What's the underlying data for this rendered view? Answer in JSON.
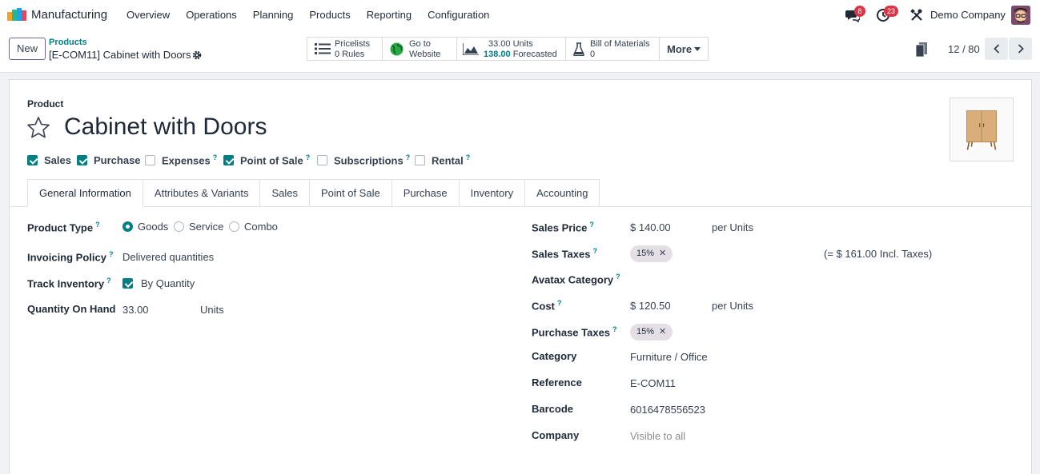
{
  "navbar": {
    "app_name": "Manufacturing",
    "menu": [
      "Overview",
      "Operations",
      "Planning",
      "Products",
      "Reporting",
      "Configuration"
    ],
    "messages_badge": "8",
    "activities_badge": "23",
    "company": "Demo Company"
  },
  "control_panel": {
    "new_label": "New",
    "breadcrumb_parent": "Products",
    "breadcrumb_current": "[E-COM11] Cabinet with Doors",
    "smart_buttons": {
      "pricelists": {
        "line1": "Pricelists",
        "line2": "0 Rules"
      },
      "website": {
        "line1": "Go to",
        "line2": "Website"
      },
      "forecast": {
        "line1": "33.00 Units",
        "line2_value": "138.00",
        "line2_label": "Forecasted"
      },
      "bom": {
        "line1": "Bill of Materials",
        "line2": "0"
      },
      "more": "More"
    },
    "pager": "12 / 80"
  },
  "form": {
    "product_label": "Product",
    "title": "Cabinet with Doors",
    "checkboxes": [
      {
        "label": "Sales",
        "checked": true,
        "help": false
      },
      {
        "label": "Purchase",
        "checked": true,
        "help": false
      },
      {
        "label": "Expenses",
        "checked": false,
        "help": true
      },
      {
        "label": "Point of Sale",
        "checked": true,
        "help": true
      },
      {
        "label": "Subscriptions",
        "checked": false,
        "help": true
      },
      {
        "label": "Rental",
        "checked": false,
        "help": true
      }
    ],
    "tabs": [
      "General Information",
      "Attributes & Variants",
      "Sales",
      "Point of Sale",
      "Purchase",
      "Inventory",
      "Accounting"
    ],
    "left": {
      "product_type_label": "Product Type",
      "product_type_options": [
        "Goods",
        "Service",
        "Combo"
      ],
      "product_type_selected": "Goods",
      "invoicing_policy_label": "Invoicing Policy",
      "invoicing_policy_value": "Delivered quantities",
      "track_inventory_label": "Track Inventory",
      "track_inventory_value": "By Quantity",
      "qty_on_hand_label": "Quantity On Hand",
      "qty_on_hand_value": "33.00",
      "qty_on_hand_uom": "Units"
    },
    "right": {
      "sales_price_label": "Sales Price",
      "sales_price_value": "$ 140.00",
      "sales_price_uom": "per Units",
      "sales_taxes_label": "Sales Taxes",
      "sales_taxes_tag": "15%",
      "sales_taxes_incl": "(= $ 161.00 Incl. Taxes)",
      "avatax_label": "Avatax Category",
      "cost_label": "Cost",
      "cost_value": "$ 120.50",
      "cost_uom": "per Units",
      "purchase_taxes_label": "Purchase Taxes",
      "purchase_taxes_tag": "15%",
      "category_label": "Category",
      "category_value": "Furniture / Office",
      "reference_label": "Reference",
      "reference_value": "E-COM11",
      "barcode_label": "Barcode",
      "barcode_value": "6016478556523",
      "company_label": "Company",
      "company_value": "Visible to all"
    },
    "help_mark": "?"
  }
}
